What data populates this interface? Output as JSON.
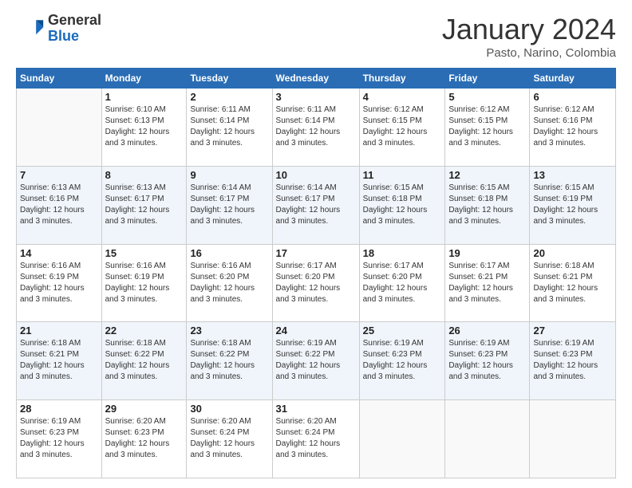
{
  "header": {
    "logo_general": "General",
    "logo_blue": "Blue",
    "month_title": "January 2024",
    "location": "Pasto, Narino, Colombia"
  },
  "calendar": {
    "days_of_week": [
      "Sunday",
      "Monday",
      "Tuesday",
      "Wednesday",
      "Thursday",
      "Friday",
      "Saturday"
    ],
    "weeks": [
      [
        {
          "day": "",
          "sunrise": "",
          "sunset": "",
          "daylight": "",
          "empty": true
        },
        {
          "day": "1",
          "sunrise": "6:10 AM",
          "sunset": "6:13 PM",
          "daylight": "12 hours and 3 minutes."
        },
        {
          "day": "2",
          "sunrise": "6:11 AM",
          "sunset": "6:14 PM",
          "daylight": "12 hours and 3 minutes."
        },
        {
          "day": "3",
          "sunrise": "6:11 AM",
          "sunset": "6:14 PM",
          "daylight": "12 hours and 3 minutes."
        },
        {
          "day": "4",
          "sunrise": "6:12 AM",
          "sunset": "6:15 PM",
          "daylight": "12 hours and 3 minutes."
        },
        {
          "day": "5",
          "sunrise": "6:12 AM",
          "sunset": "6:15 PM",
          "daylight": "12 hours and 3 minutes."
        },
        {
          "day": "6",
          "sunrise": "6:12 AM",
          "sunset": "6:16 PM",
          "daylight": "12 hours and 3 minutes."
        }
      ],
      [
        {
          "day": "7",
          "sunrise": "6:13 AM",
          "sunset": "6:16 PM",
          "daylight": "12 hours and 3 minutes."
        },
        {
          "day": "8",
          "sunrise": "6:13 AM",
          "sunset": "6:17 PM",
          "daylight": "12 hours and 3 minutes."
        },
        {
          "day": "9",
          "sunrise": "6:14 AM",
          "sunset": "6:17 PM",
          "daylight": "12 hours and 3 minutes."
        },
        {
          "day": "10",
          "sunrise": "6:14 AM",
          "sunset": "6:17 PM",
          "daylight": "12 hours and 3 minutes."
        },
        {
          "day": "11",
          "sunrise": "6:15 AM",
          "sunset": "6:18 PM",
          "daylight": "12 hours and 3 minutes."
        },
        {
          "day": "12",
          "sunrise": "6:15 AM",
          "sunset": "6:18 PM",
          "daylight": "12 hours and 3 minutes."
        },
        {
          "day": "13",
          "sunrise": "6:15 AM",
          "sunset": "6:19 PM",
          "daylight": "12 hours and 3 minutes."
        }
      ],
      [
        {
          "day": "14",
          "sunrise": "6:16 AM",
          "sunset": "6:19 PM",
          "daylight": "12 hours and 3 minutes."
        },
        {
          "day": "15",
          "sunrise": "6:16 AM",
          "sunset": "6:19 PM",
          "daylight": "12 hours and 3 minutes."
        },
        {
          "day": "16",
          "sunrise": "6:16 AM",
          "sunset": "6:20 PM",
          "daylight": "12 hours and 3 minutes."
        },
        {
          "day": "17",
          "sunrise": "6:17 AM",
          "sunset": "6:20 PM",
          "daylight": "12 hours and 3 minutes."
        },
        {
          "day": "18",
          "sunrise": "6:17 AM",
          "sunset": "6:20 PM",
          "daylight": "12 hours and 3 minutes."
        },
        {
          "day": "19",
          "sunrise": "6:17 AM",
          "sunset": "6:21 PM",
          "daylight": "12 hours and 3 minutes."
        },
        {
          "day": "20",
          "sunrise": "6:18 AM",
          "sunset": "6:21 PM",
          "daylight": "12 hours and 3 minutes."
        }
      ],
      [
        {
          "day": "21",
          "sunrise": "6:18 AM",
          "sunset": "6:21 PM",
          "daylight": "12 hours and 3 minutes."
        },
        {
          "day": "22",
          "sunrise": "6:18 AM",
          "sunset": "6:22 PM",
          "daylight": "12 hours and 3 minutes."
        },
        {
          "day": "23",
          "sunrise": "6:18 AM",
          "sunset": "6:22 PM",
          "daylight": "12 hours and 3 minutes."
        },
        {
          "day": "24",
          "sunrise": "6:19 AM",
          "sunset": "6:22 PM",
          "daylight": "12 hours and 3 minutes."
        },
        {
          "day": "25",
          "sunrise": "6:19 AM",
          "sunset": "6:23 PM",
          "daylight": "12 hours and 3 minutes."
        },
        {
          "day": "26",
          "sunrise": "6:19 AM",
          "sunset": "6:23 PM",
          "daylight": "12 hours and 3 minutes."
        },
        {
          "day": "27",
          "sunrise": "6:19 AM",
          "sunset": "6:23 PM",
          "daylight": "12 hours and 3 minutes."
        }
      ],
      [
        {
          "day": "28",
          "sunrise": "6:19 AM",
          "sunset": "6:23 PM",
          "daylight": "12 hours and 3 minutes."
        },
        {
          "day": "29",
          "sunrise": "6:20 AM",
          "sunset": "6:23 PM",
          "daylight": "12 hours and 3 minutes."
        },
        {
          "day": "30",
          "sunrise": "6:20 AM",
          "sunset": "6:24 PM",
          "daylight": "12 hours and 3 minutes."
        },
        {
          "day": "31",
          "sunrise": "6:20 AM",
          "sunset": "6:24 PM",
          "daylight": "12 hours and 3 minutes."
        },
        {
          "day": "",
          "sunrise": "",
          "sunset": "",
          "daylight": "",
          "empty": true
        },
        {
          "day": "",
          "sunrise": "",
          "sunset": "",
          "daylight": "",
          "empty": true
        },
        {
          "day": "",
          "sunrise": "",
          "sunset": "",
          "daylight": "",
          "empty": true
        }
      ]
    ]
  }
}
